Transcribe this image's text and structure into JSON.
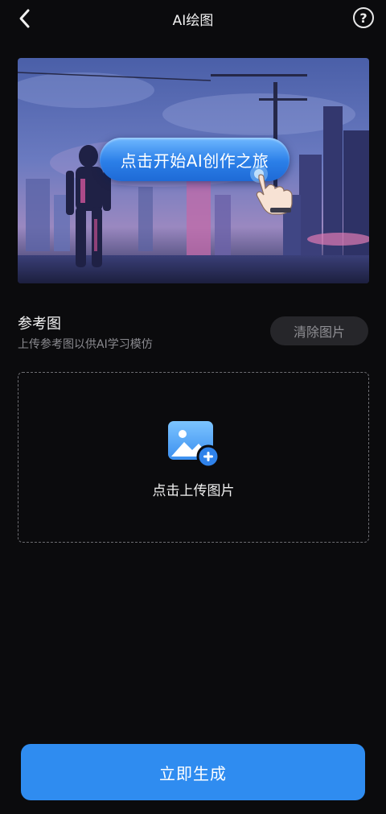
{
  "header": {
    "back_icon": "chevron-left-icon",
    "title": "AI绘图",
    "help_label": "?"
  },
  "banner": {
    "button_label": "点击开始AI创作之旅",
    "hand_icon": "pointing-hand-icon"
  },
  "reference": {
    "title": "参考图",
    "subtitle": "上传参考图以供AI学习模仿",
    "clear_label": "清除图片"
  },
  "upload": {
    "icon": "add-image-icon",
    "label": "点击上传图片"
  },
  "footer": {
    "generate_label": "立即生成"
  },
  "colors": {
    "background": "#0b0b0d",
    "accent": "#2f8cf0",
    "secondary_button": "#26262a",
    "muted_text": "#8a8a8f"
  }
}
